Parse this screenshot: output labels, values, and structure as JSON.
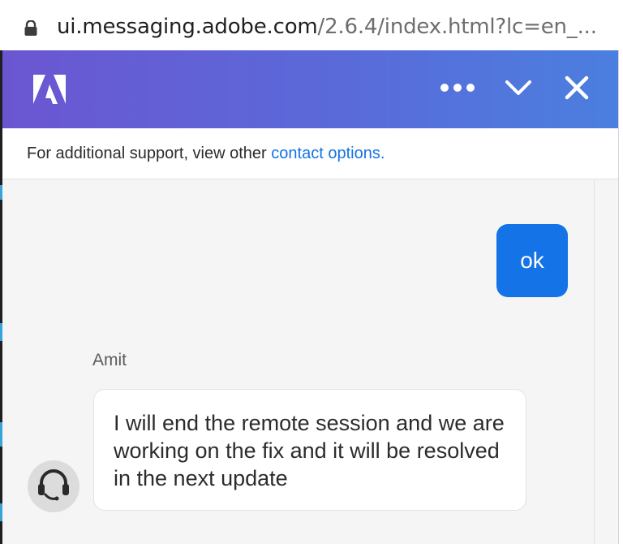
{
  "browser": {
    "url_host": "ui.messaging.adobe.com",
    "url_path": "/2.6.4/index.html?lc=en_..."
  },
  "header": {
    "logo_icon": "adobe-logo-icon",
    "more_icon": "more-dots-icon",
    "collapse_icon": "chevron-down-icon",
    "close_icon": "close-icon",
    "gradient_colors": [
      "#6b56d1",
      "#4b7fdf"
    ]
  },
  "banner": {
    "text": "For additional support, view other ",
    "link": "contact options."
  },
  "chat": {
    "user_message": "ok",
    "agent_name": "Amit",
    "agent_message": "I will end the remote session and we are working on the fix and it will be resolved in the next update",
    "agent_avatar_icon": "headset-icon",
    "user_bubble_color": "#1473e6"
  }
}
